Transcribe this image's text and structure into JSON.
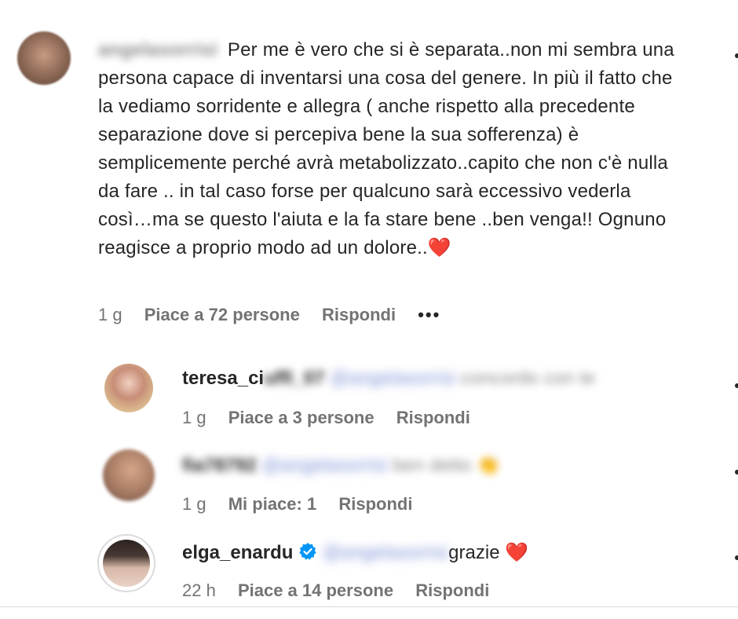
{
  "comment": {
    "username": "angelasorrisi",
    "text": "Per me è vero che si è separata..non mi sembra una persona capace di inventarsi una cosa del genere. In più il fatto che la vediamo sorridente e allegra ( anche rispetto alla precedente separazione dove si percepiva bene la sua sofferenza) è semplicemente perché avrà metabolizzato..capito che non c'è nulla da fare .. in tal caso forse per qualcuno sarà eccessivo vederla così…ma se questo l'aiuta e la fa stare bene ..ben venga!! Ognuno reagisce a proprio modo ad un dolore..",
    "emoji": "❤️",
    "time": "1 g",
    "likes": "Piace a 72 persone",
    "reply": "Rispondi",
    "more": "•••"
  },
  "replies": [
    {
      "username": "teresa_ci",
      "username_blur": "uffi_07",
      "mention": "@angelasorrisi",
      "text": "concordo con te",
      "time": "1 g",
      "likes": "Piace a 3 persone",
      "reply": "Rispondi"
    },
    {
      "username": "fia78792",
      "mention": "@angelasorrisi",
      "text": "ben detto 👏",
      "time": "1 g",
      "likes": "Mi piace: 1",
      "reply": "Rispondi"
    },
    {
      "username": "elga_enardu",
      "verified": true,
      "mention": "@angelasorrisi",
      "text": "grazie",
      "emoji": "❤️",
      "time": "22 h",
      "likes": "Piace a 14 persone",
      "reply": "Rispondi"
    }
  ],
  "colors": {
    "text": "#262626",
    "meta": "#737373",
    "verified": "#0095f6",
    "heart": "#ed1c24"
  }
}
